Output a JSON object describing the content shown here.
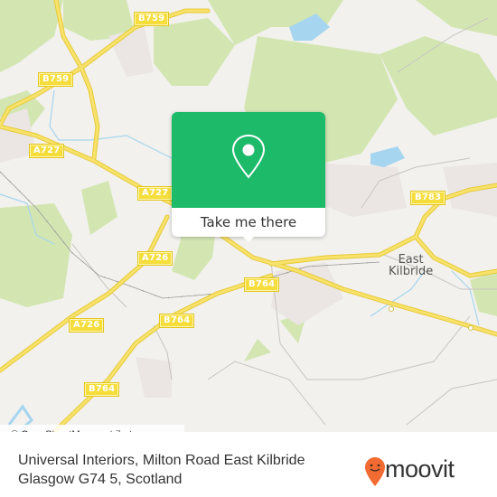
{
  "map": {
    "road_labels": [
      {
        "id": "b759-top",
        "label": "B759"
      },
      {
        "id": "b759-left",
        "label": "B759"
      },
      {
        "id": "a727-left",
        "label": "A727"
      },
      {
        "id": "a727-mid",
        "label": "A727"
      },
      {
        "id": "a726-upper",
        "label": "A726"
      },
      {
        "id": "a726-lower",
        "label": "A726"
      },
      {
        "id": "b764-mid",
        "label": "B764"
      },
      {
        "id": "b764-lower",
        "label": "B764"
      },
      {
        "id": "b764-bottom",
        "label": "B764"
      },
      {
        "id": "b783",
        "label": "B783"
      }
    ],
    "place_label": {
      "line1": "East",
      "line2": "Kilbride"
    },
    "attribution": "© OpenStreetMap contributors",
    "colors": {
      "road_major": "#f5dd3c",
      "water": "#a6d5f0",
      "green": "#cde3a8",
      "background": "#f2f1ed"
    }
  },
  "popup": {
    "icon": "location-pin-icon",
    "button_label": "Take me there",
    "color": "#1dba6a"
  },
  "footer": {
    "address_line1": "Universal Interiors, Milton Road East Kilbride",
    "address_line2": "Glasgow G74 5, Scotland",
    "brand": "moovit",
    "brand_color": "#f26b32"
  }
}
